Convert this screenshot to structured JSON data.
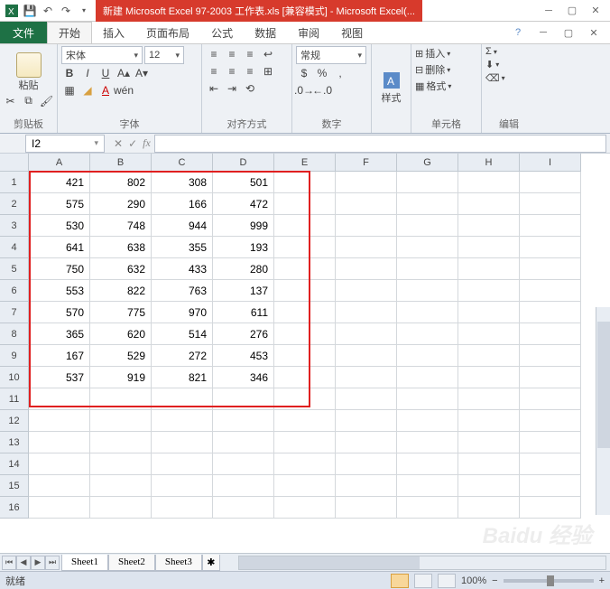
{
  "title": "新建 Microsoft Excel 97-2003 工作表.xls  [兼容模式]  -  Microsoft Excel(...",
  "file_tab": "文件",
  "tabs": [
    "开始",
    "插入",
    "页面布局",
    "公式",
    "数据",
    "审阅",
    "视图"
  ],
  "active_tab": 0,
  "ribbon": {
    "clipboard": {
      "paste": "粘贴",
      "label": "剪贴板"
    },
    "font": {
      "name": "宋体",
      "size": "12",
      "label": "字体"
    },
    "align": {
      "label": "对齐方式"
    },
    "number": {
      "format": "常规",
      "label": "数字"
    },
    "styles": {
      "btn": "样式",
      "label": ""
    },
    "cells": {
      "insert": "插入",
      "delete": "删除",
      "format": "格式",
      "label": "单元格"
    },
    "editing": {
      "label": "编辑"
    }
  },
  "name_box": "I2",
  "formula": "",
  "columns": [
    "A",
    "B",
    "C",
    "D",
    "E",
    "F",
    "G",
    "H",
    "I"
  ],
  "row_count": 16,
  "chart_data": {
    "type": "table",
    "columns": [
      "A",
      "B",
      "C",
      "D"
    ],
    "rows": [
      [
        421,
        802,
        308,
        501
      ],
      [
        575,
        290,
        166,
        472
      ],
      [
        530,
        748,
        944,
        999
      ],
      [
        641,
        638,
        355,
        193
      ],
      [
        750,
        632,
        433,
        280
      ],
      [
        553,
        822,
        763,
        137
      ],
      [
        570,
        775,
        970,
        611
      ],
      [
        365,
        620,
        514,
        276
      ],
      [
        167,
        529,
        272,
        453
      ],
      [
        537,
        919,
        821,
        346
      ]
    ]
  },
  "sheets": [
    "Sheet1",
    "Sheet2",
    "Sheet3"
  ],
  "active_sheet": 0,
  "status": "就绪",
  "zoom": "100%",
  "watermark": "Baidu 经验"
}
